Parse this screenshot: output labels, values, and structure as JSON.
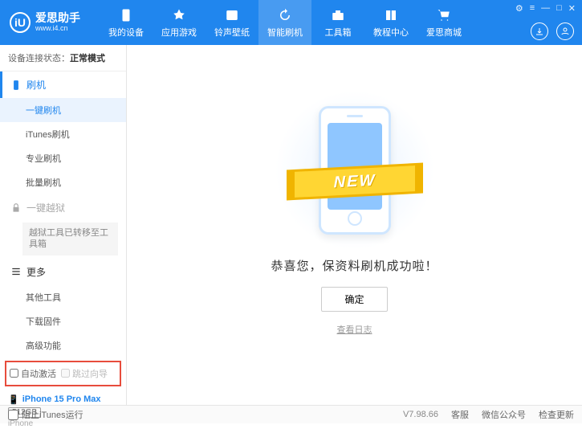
{
  "logo": {
    "glyph": "iU",
    "title": "爱思助手",
    "url": "www.i4.cn"
  },
  "titlebar": {
    "settings": "⚙",
    "menu": "≡",
    "min": "—",
    "max": "□",
    "close": "✕"
  },
  "nav": [
    {
      "label": "我的设备"
    },
    {
      "label": "应用游戏"
    },
    {
      "label": "铃声壁纸"
    },
    {
      "label": "智能刷机",
      "active": true
    },
    {
      "label": "工具箱"
    },
    {
      "label": "教程中心"
    },
    {
      "label": "爱思商城"
    }
  ],
  "status": {
    "label": "设备连接状态：",
    "value": "正常模式"
  },
  "sidebar": {
    "flash": {
      "title": "刷机",
      "items": [
        "一键刷机",
        "iTunes刷机",
        "专业刷机",
        "批量刷机"
      ],
      "activeIndex": 0
    },
    "jailbreak": {
      "title": "一键越狱",
      "note": "越狱工具已转移至工具箱"
    },
    "more": {
      "title": "更多",
      "items": [
        "其他工具",
        "下载固件",
        "高级功能"
      ]
    },
    "checks": {
      "auto_activate": "自动激活",
      "skip_guide": "跳过向导"
    },
    "device": {
      "name": "iPhone 15 Pro Max",
      "storage": "512GB",
      "type": "iPhone"
    }
  },
  "main": {
    "ribbon": "NEW",
    "message": "恭喜您，保资料刷机成功啦！",
    "ok": "确定",
    "view_log": "查看日志"
  },
  "footer": {
    "block_itunes": "阻止iTunes运行",
    "version": "V7.98.66",
    "support": "客服",
    "wechat": "微信公众号",
    "check_update": "检查更新"
  }
}
